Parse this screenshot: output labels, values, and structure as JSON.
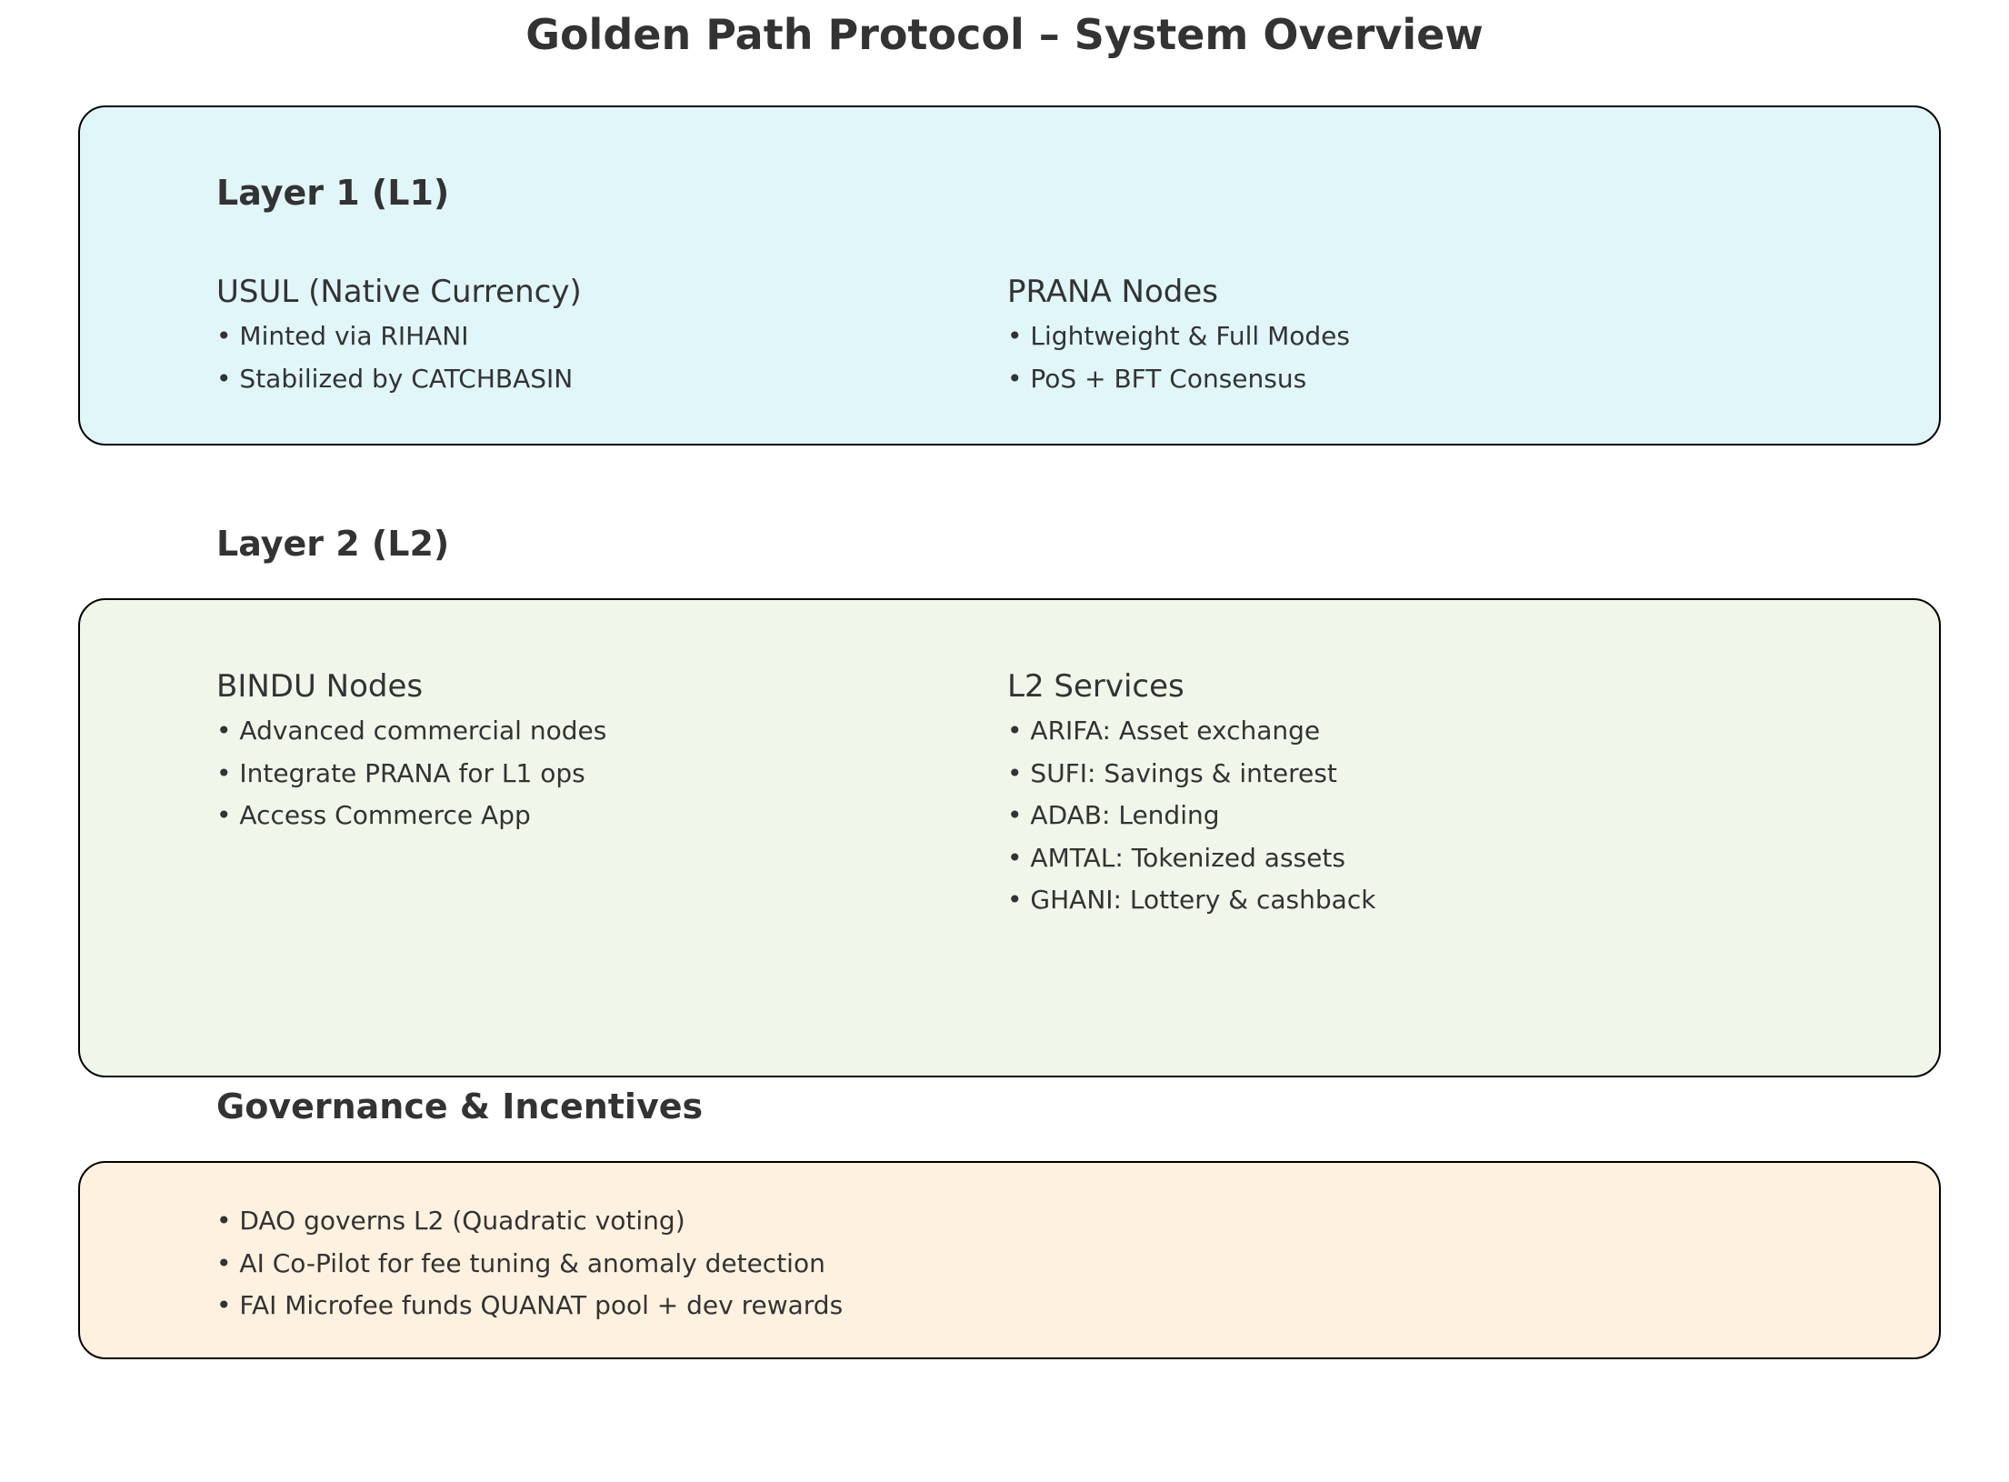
{
  "title": "Golden Path Protocol – System Overview",
  "colors": {
    "layer1_bg": "#e0f6f9",
    "layer2_bg": "#f0f6ea",
    "governance_bg": "#fff1df",
    "border": "#000000",
    "text": "#333333"
  },
  "layer1": {
    "heading": "Layer 1 (L1)",
    "usul": {
      "title": "USUL (Native Currency)",
      "bullets": [
        "• Minted via RIHANI",
        "• Stabilized by CATCHBASIN"
      ]
    },
    "prana": {
      "title": "PRANA Nodes",
      "bullets": [
        "• Lightweight & Full Modes",
        "• PoS + BFT Consensus"
      ]
    }
  },
  "layer2": {
    "heading": "Layer 2 (L2)",
    "bindu": {
      "title": "BINDU Nodes",
      "bullets": [
        "• Advanced commercial nodes",
        "• Integrate PRANA for L1 ops",
        "• Access Commerce App"
      ]
    },
    "services": {
      "title": "L2 Services",
      "bullets": [
        "• ARIFA: Asset exchange",
        "• SUFI: Savings & interest",
        "• ADAB: Lending",
        "• AMTAL: Tokenized assets",
        "• GHANI: Lottery & cashback"
      ]
    }
  },
  "governance": {
    "heading": "Governance & Incentives",
    "bullets": [
      "• DAO governs L2 (Quadratic voting)",
      "• AI Co-Pilot for fee tuning & anomaly detection",
      "• FAI Microfee funds QUANAT pool + dev rewards"
    ]
  }
}
